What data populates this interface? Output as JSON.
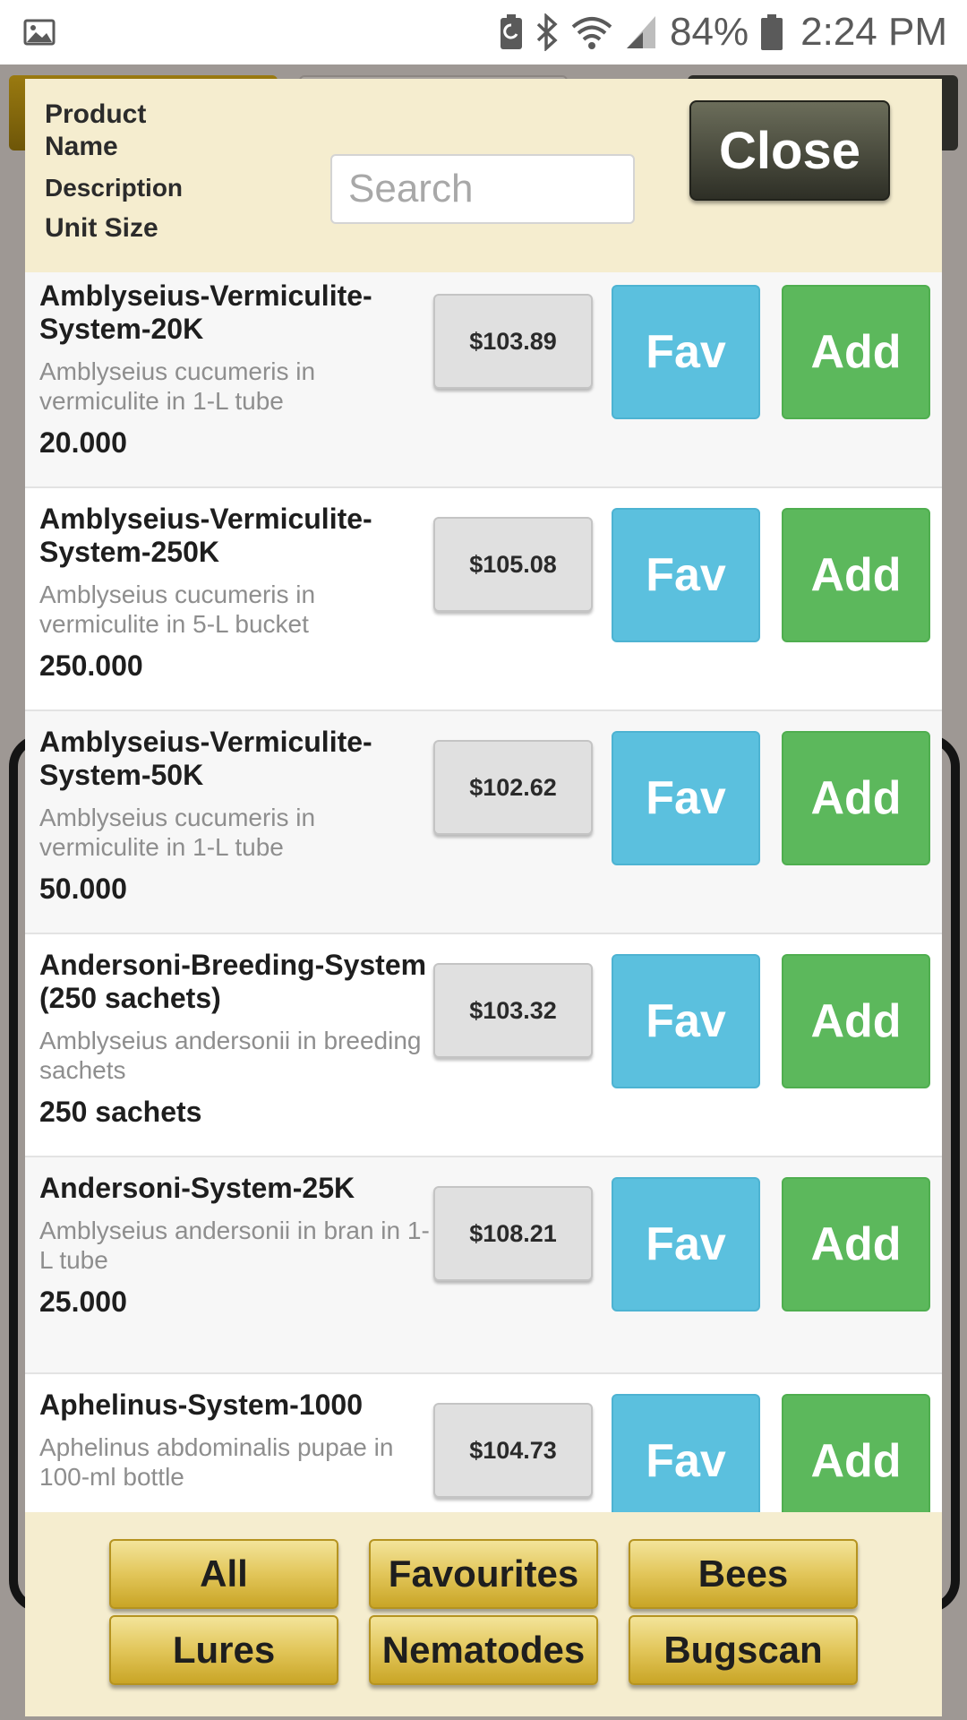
{
  "status_bar": {
    "battery_percent": "84%",
    "time": "2:24 PM",
    "icons": [
      "image-icon",
      "battery-saver-icon",
      "bluetooth-icon",
      "wifi-icon",
      "signal-icon",
      "battery-icon"
    ]
  },
  "header": {
    "col_name": "Product Name",
    "col_description": "Description",
    "col_unit": "Unit Size",
    "search_placeholder": "Search",
    "search_value": "",
    "close_label": "Close"
  },
  "products": [
    {
      "name": "Amblyseius-Vermiculite-System-20K",
      "description": "Amblyseius cucumeris in vermiculite in 1-L tube",
      "unit": "20.000",
      "price": "$103.89",
      "fav_label": "Fav",
      "add_label": "Add"
    },
    {
      "name": "Amblyseius-Vermiculite-System-250K",
      "description": "Amblyseius cucumeris in vermiculite in 5-L bucket",
      "unit": "250.000",
      "price": "$105.08",
      "fav_label": "Fav",
      "add_label": "Add"
    },
    {
      "name": "Amblyseius-Vermiculite-System-50K",
      "description": "Amblyseius cucumeris in vermiculite in 1-L tube",
      "unit": "50.000",
      "price": "$102.62",
      "fav_label": "Fav",
      "add_label": "Add"
    },
    {
      "name": "Andersoni-Breeding-System (250 sachets)",
      "description": "Amblyseius andersonii in breeding sachets",
      "unit": "250 sachets",
      "price": "$103.32",
      "fav_label": "Fav",
      "add_label": "Add"
    },
    {
      "name": "Andersoni-System-25K",
      "description": "Amblyseius andersonii in bran in 1-L tube",
      "unit": "25.000",
      "price": "$108.21",
      "fav_label": "Fav",
      "add_label": "Add"
    },
    {
      "name": "Aphelinus-System-1000",
      "description": "Aphelinus abdominalis pupae in 100-ml bottle",
      "unit": "",
      "price": "$104.73",
      "fav_label": "Fav",
      "add_label": "Add"
    }
  ],
  "footer": {
    "buttons": [
      "All",
      "Favourites",
      "Bees",
      "Lures",
      "Nematodes",
      "Bugscan"
    ]
  },
  "colors": {
    "header_bg": "#f5edcf",
    "fav": "#5bc0de",
    "add": "#5cb85c",
    "close": "#3f4035",
    "category_gold": "#e2c65a"
  }
}
